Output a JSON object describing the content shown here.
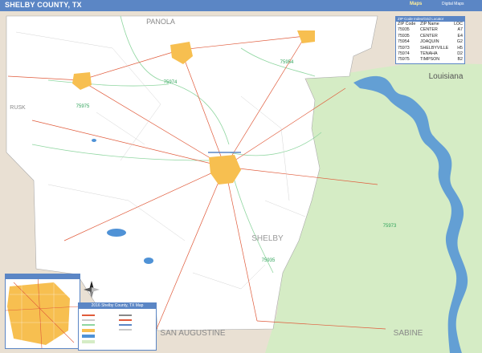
{
  "header": {
    "title": "SHELBY COUNTY, TX",
    "logo_text": "Maps",
    "logo_sub": "Digital Maps"
  },
  "colors": {
    "title_bar": "#5b86c5",
    "green_area": "#d5ecc5",
    "neighbor_county": "#e9e0d3",
    "water": "#4f92d6",
    "city": "#f7bf50",
    "highway": "#e05a3a",
    "zip_boundary": "#8fd6a0"
  },
  "labels": {
    "neighbors": [
      "PANOLA",
      "RUSK",
      "SAN AUGUSTINE",
      "SABINE"
    ],
    "state": "Louisiana",
    "county": "SHELBY",
    "zip_on_map": [
      "75954",
      "75974",
      "75975",
      "75935",
      "75973"
    ]
  },
  "zip_table": {
    "title": "ZIP Code Index/Grid Locator",
    "headers": [
      "ZIP Code",
      "ZIP Name",
      "LOC"
    ],
    "rows": [
      [
        "75935",
        "CENTER",
        "A7"
      ],
      [
        "75935",
        "CENTER",
        "E4"
      ],
      [
        "75954",
        "JOAQUIN",
        "G2"
      ],
      [
        "75973",
        "SHELBYVILLE",
        "H5"
      ],
      [
        "75974",
        "TENAHA",
        "D2"
      ],
      [
        "75975",
        "TIMPSON",
        "B2"
      ]
    ]
  },
  "legend": {
    "title": "2016 Shelby County, TX Map"
  },
  "icons": {
    "compass": "north-arrow-icon"
  }
}
